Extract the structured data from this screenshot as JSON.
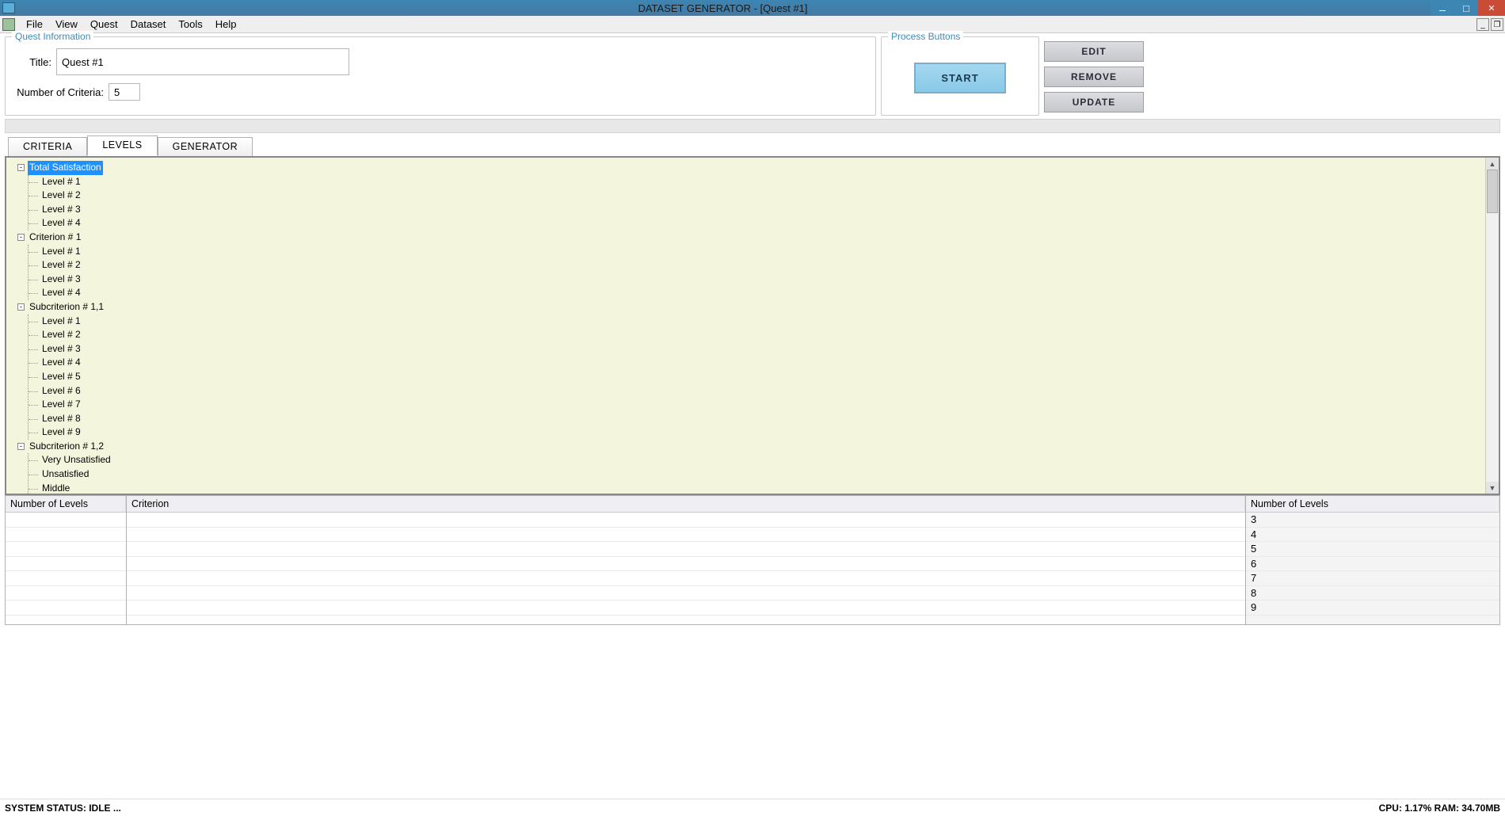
{
  "window": {
    "title": "DATASET GENERATOR - [Quest #1]"
  },
  "menu": {
    "file": "File",
    "view": "View",
    "quest": "Quest",
    "dataset": "Dataset",
    "tools": "Tools",
    "help": "Help"
  },
  "quest_info": {
    "legend": "Quest Information",
    "title_label": "Title:",
    "title_value": "Quest #1",
    "criteria_label": "Number of Criteria:",
    "criteria_value": "5"
  },
  "process": {
    "legend": "Process Buttons",
    "start": "START"
  },
  "actions": {
    "edit": "EDIT",
    "remove": "REMOVE",
    "update": "UPDATE"
  },
  "tabs": {
    "criteria": "CRITERIA",
    "levels": "LEVELS",
    "generator": "GENERATOR"
  },
  "tree": {
    "n0": {
      "label": "Total Satisfaction",
      "children": [
        "Level # 1",
        "Level # 2",
        "Level # 3",
        "Level # 4"
      ]
    },
    "n1": {
      "label": "Criterion # 1",
      "children": [
        "Level # 1",
        "Level # 2",
        "Level # 3",
        "Level # 4"
      ]
    },
    "n2": {
      "label": "Subcriterion # 1,1",
      "children": [
        "Level # 1",
        "Level # 2",
        "Level # 3",
        "Level # 4",
        "Level # 5",
        "Level # 6",
        "Level # 7",
        "Level # 8",
        "Level # 9"
      ]
    },
    "n3": {
      "label": "Subcriterion # 1,2",
      "children": [
        "Very Unsatisfied",
        "Unsatisfied",
        "Middle"
      ]
    }
  },
  "table_left": {
    "header": "Number of Levels"
  },
  "table_mid": {
    "header": "Criterion"
  },
  "table_right": {
    "header": "Number of Levels",
    "rows": [
      "3",
      "4",
      "5",
      "6",
      "7",
      "8",
      "9"
    ]
  },
  "status": {
    "left": "SYSTEM STATUS: IDLE ...",
    "right": "CPU: 1.17% RAM: 34.70MB"
  }
}
